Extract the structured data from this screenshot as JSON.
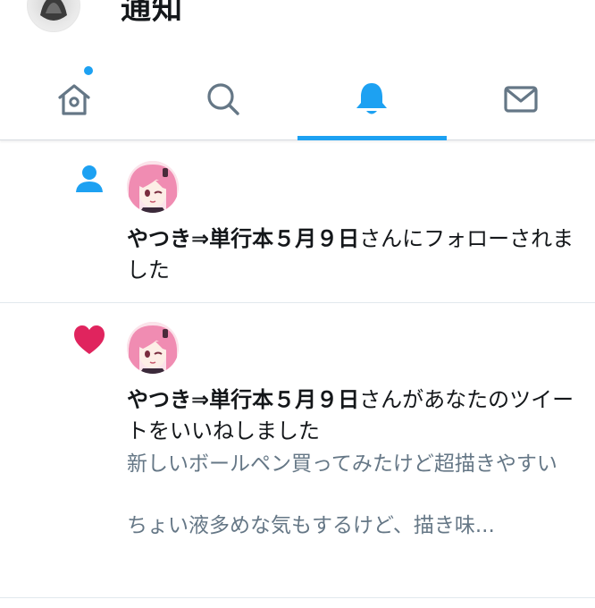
{
  "header": {
    "title": "通知",
    "avatar_icon": "user-avatar-icon"
  },
  "tabs": [
    {
      "name": "home",
      "icon": "home-icon",
      "active": false,
      "has_new": true
    },
    {
      "name": "search",
      "icon": "search-icon",
      "active": false,
      "has_new": false
    },
    {
      "name": "notifications",
      "icon": "bell-icon",
      "active": true,
      "has_new": false
    },
    {
      "name": "messages",
      "icon": "mail-icon",
      "active": false,
      "has_new": false
    }
  ],
  "colors": {
    "accent": "#1da1f2",
    "like": "#e0245e",
    "secondary_text": "#657786",
    "primary_text": "#14171a"
  },
  "notifications": [
    {
      "type": "follow",
      "type_icon": "person-icon",
      "actor": "やつき⇒単行本５月９日",
      "text": "さんにフォローされました"
    },
    {
      "type": "like",
      "type_icon": "heart-icon",
      "actor": "やつき⇒単行本５月９日",
      "text": "さんがあなたのツイートをいいねしました",
      "tweet_line1": "新しいボールペン買ってみたけど超描きやすい",
      "tweet_line2": "ちょい液多めな気もするけど、描き味..."
    }
  ]
}
